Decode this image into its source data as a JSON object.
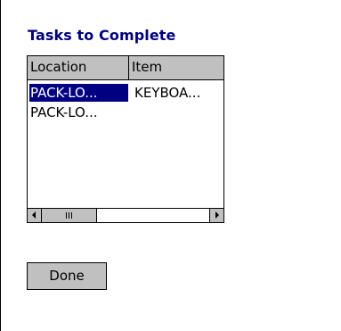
{
  "title": "Tasks to Complete",
  "list": {
    "columns": [
      "Location",
      "Item"
    ],
    "rows": [
      {
        "location": "PACK-LO...",
        "item": "KEYBOA...",
        "selected": true
      },
      {
        "location": "PACK-LO...",
        "item": "",
        "selected": false
      }
    ],
    "scrollbar_thumb_glyph": "III"
  },
  "buttons": {
    "done_label": "Done"
  },
  "colors": {
    "title": "#000080",
    "selection_bg": "#000080",
    "control_face": "#c0c0c0"
  }
}
